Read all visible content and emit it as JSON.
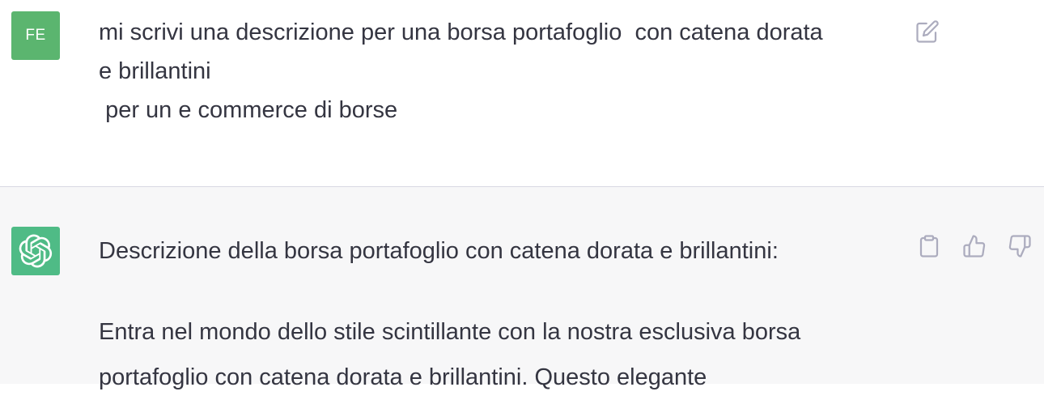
{
  "user_message": {
    "avatar_initials": "FE",
    "text": "mi scrivi una descrizione per una borsa portafoglio  con catena dorata\ne brillantini\n per un e commerce di borse",
    "icons": {
      "edit": "edit-icon"
    }
  },
  "assistant_message": {
    "avatar_icon": "openai-logo-icon",
    "title": "Descrizione della borsa portafoglio con catena dorata e brillantini:",
    "paragraph": "Entra nel mondo dello stile scintillante con la nostra esclusiva borsa portafoglio con catena dorata e brillantini. Questo elegante",
    "icons": {
      "copy": "clipboard-icon",
      "like": "thumbs-up-icon",
      "dislike": "thumbs-down-icon"
    }
  },
  "colors": {
    "user_avatar": "#5bb56f",
    "assistant_avatar": "#4fbb86",
    "assistant_bg": "#f7f7f8",
    "text": "#343541",
    "icon": "#acacbe"
  }
}
